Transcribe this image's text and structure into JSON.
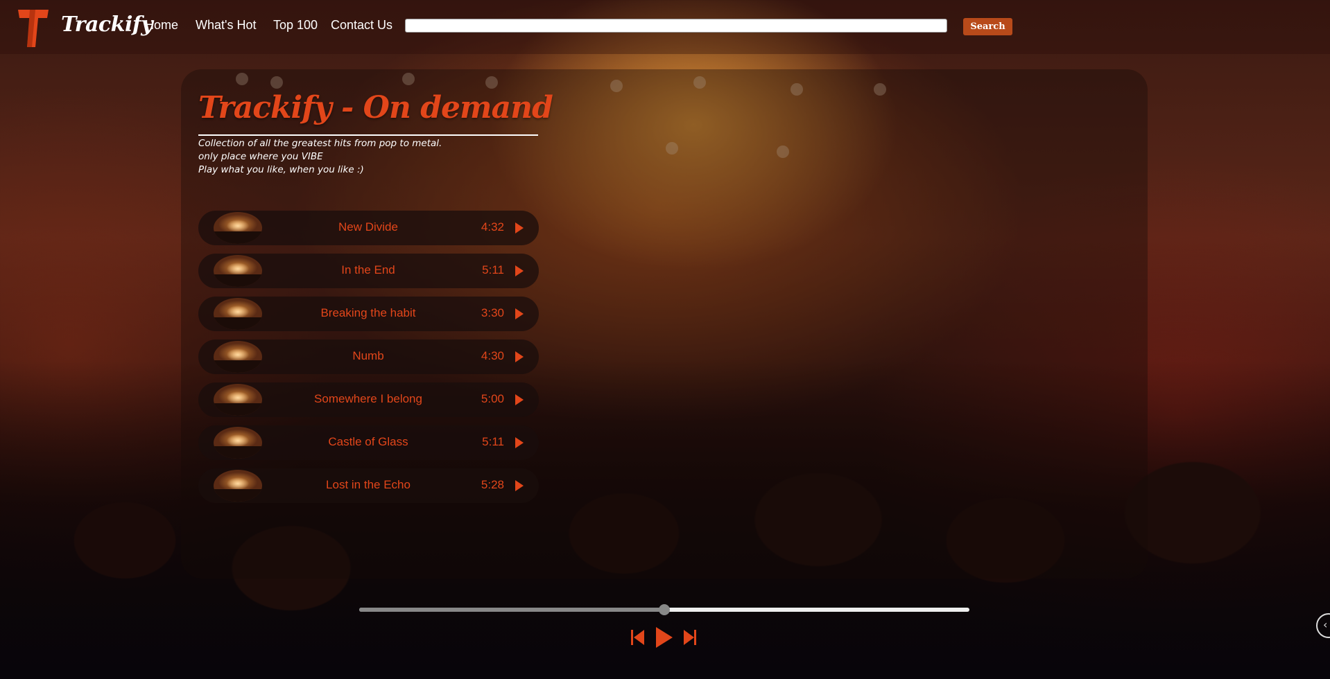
{
  "brand": {
    "name": "Trackify",
    "logo_icon": "trackify-t-logo-icon",
    "accent": "#e2461a"
  },
  "nav": {
    "links": [
      {
        "label": "Home"
      },
      {
        "label": "What's Hot"
      },
      {
        "label": "Top 100"
      },
      {
        "label": "Contact Us"
      }
    ],
    "search": {
      "value": "",
      "placeholder": "",
      "button_label": "Search"
    }
  },
  "main": {
    "title": "Trackify - On demand",
    "description_lines": [
      "Collection of all the greatest hits from pop to metal.",
      "only place where you VIBE",
      "Play what you like, when you like :)"
    ],
    "tracks": [
      {
        "title": "New Divide",
        "duration": "4:32"
      },
      {
        "title": "In the End",
        "duration": "5:11"
      },
      {
        "title": "Breaking the habit",
        "duration": "3:30"
      },
      {
        "title": "Numb",
        "duration": "4:30"
      },
      {
        "title": "Somewhere I belong",
        "duration": "5:00"
      },
      {
        "title": "Castle of Glass",
        "duration": "5:11"
      },
      {
        "title": "Lost in the Echo",
        "duration": "5:28"
      }
    ]
  },
  "player": {
    "progress": 0.5,
    "controls": [
      "previous-icon",
      "play-icon",
      "next-icon"
    ]
  },
  "colors": {
    "accent": "#e2461a",
    "search_button": "#b84a1a"
  }
}
